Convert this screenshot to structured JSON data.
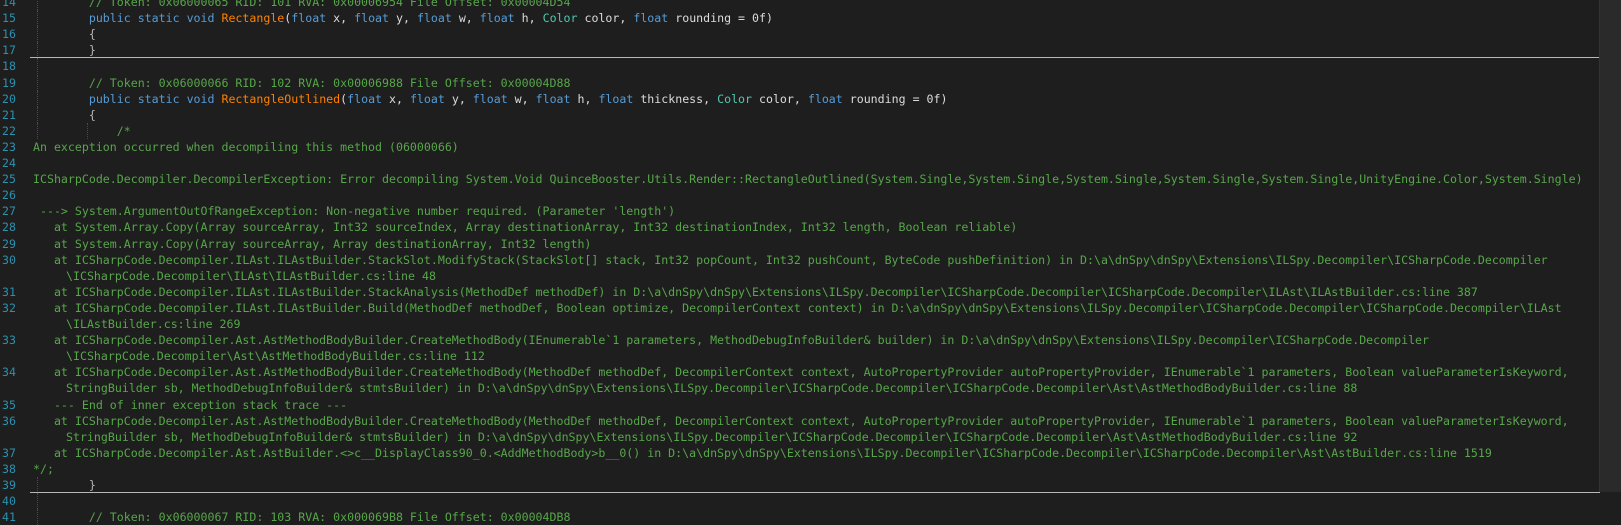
{
  "lines": [
    {
      "n": "14",
      "text": "        // Token: 0x06000065 RID: 101 RVA: 0x00006954 File Offset: 0x00004D54",
      "cls": "cm",
      "indent": 1
    },
    {
      "n": "15",
      "sig": {
        "pre": "public static void ",
        "name": "Rectangle",
        "args": "(float x, float y, float w, float h, Color color, float rounding = 0f)"
      },
      "indent": 1
    },
    {
      "n": "16",
      "text": "        {",
      "cls": "punc",
      "indent": 1
    },
    {
      "n": "17",
      "text": "        }",
      "cls": "punc",
      "indent": 1,
      "sep_after": true
    },
    {
      "n": "18",
      "text": "",
      "indent": 1
    },
    {
      "n": "19",
      "text": "        // Token: 0x06000066 RID: 102 RVA: 0x00006988 File Offset: 0x00004D88",
      "cls": "cm",
      "indent": 1
    },
    {
      "n": "20",
      "sig": {
        "pre": "public static void ",
        "name": "RectangleOutlined",
        "args": "(float x, float y, float w, float h, float thickness, Color color, float rounding = 0f)"
      },
      "indent": 1
    },
    {
      "n": "21",
      "text": "        {",
      "cls": "punc",
      "indent": 1
    },
    {
      "n": "22",
      "text": "            /*",
      "cls": "cm",
      "indent": 2
    },
    {
      "n": "23",
      "text": "An exception occurred when decompiling this method (06000066)",
      "cls": "cm"
    },
    {
      "n": "24",
      "text": "",
      "cls": "cm"
    },
    {
      "n": "25",
      "text": "ICSharpCode.Decompiler.DecompilerException: Error decompiling System.Void QuinceBooster.Utils.Render::RectangleOutlined(System.Single,System.Single,System.Single,System.Single,System.Single,UnityEngine.Color,System.Single)",
      "cls": "cm"
    },
    {
      "n": "26",
      "text": "",
      "cls": "cm"
    },
    {
      "n": "27",
      "text": " ---> System.ArgumentOutOfRangeException: Non-negative number required. (Parameter 'length')",
      "cls": "cm"
    },
    {
      "n": "28",
      "text": "   at System.Array.Copy(Array sourceArray, Int32 sourceIndex, Array destinationArray, Int32 destinationIndex, Int32 length, Boolean reliable)",
      "cls": "cm"
    },
    {
      "n": "29",
      "text": "   at System.Array.Copy(Array sourceArray, Array destinationArray, Int32 length)",
      "cls": "cm"
    },
    {
      "n": "30",
      "text": "   at ICSharpCode.Decompiler.ILAst.ILAstBuilder.StackSlot.ModifyStack(StackSlot[] stack, Int32 popCount, Int32 pushCount, ByteCode pushDefinition) in D:\\a\\dnSpy\\dnSpy\\Extensions\\ILSpy.Decompiler\\ICSharpCode.Decompiler",
      "cls": "cm"
    },
    {
      "n": "",
      "text": "\\ICSharpCode.Decompiler\\ILAst\\ILAstBuilder.cs:line 48",
      "cls": "cm",
      "cont": true
    },
    {
      "n": "31",
      "text": "   at ICSharpCode.Decompiler.ILAst.ILAstBuilder.StackAnalysis(MethodDef methodDef) in D:\\a\\dnSpy\\dnSpy\\Extensions\\ILSpy.Decompiler\\ICSharpCode.Decompiler\\ICSharpCode.Decompiler\\ILAst\\ILAstBuilder.cs:line 387",
      "cls": "cm"
    },
    {
      "n": "32",
      "text": "   at ICSharpCode.Decompiler.ILAst.ILAstBuilder.Build(MethodDef methodDef, Boolean optimize, DecompilerContext context) in D:\\a\\dnSpy\\dnSpy\\Extensions\\ILSpy.Decompiler\\ICSharpCode.Decompiler\\ICSharpCode.Decompiler\\ILAst",
      "cls": "cm"
    },
    {
      "n": "",
      "text": "\\ILAstBuilder.cs:line 269",
      "cls": "cm",
      "cont": true
    },
    {
      "n": "33",
      "text": "   at ICSharpCode.Decompiler.Ast.AstMethodBodyBuilder.CreateMethodBody(IEnumerable`1 parameters, MethodDebugInfoBuilder& builder) in D:\\a\\dnSpy\\dnSpy\\Extensions\\ILSpy.Decompiler\\ICSharpCode.Decompiler",
      "cls": "cm"
    },
    {
      "n": "",
      "text": "\\ICSharpCode.Decompiler\\Ast\\AstMethodBodyBuilder.cs:line 112",
      "cls": "cm",
      "cont": true
    },
    {
      "n": "34",
      "text": "   at ICSharpCode.Decompiler.Ast.AstMethodBodyBuilder.CreateMethodBody(MethodDef methodDef, DecompilerContext context, AutoPropertyProvider autoPropertyProvider, IEnumerable`1 parameters, Boolean valueParameterIsKeyword,",
      "cls": "cm"
    },
    {
      "n": "",
      "text": "StringBuilder sb, MethodDebugInfoBuilder& stmtsBuilder) in D:\\a\\dnSpy\\dnSpy\\Extensions\\ILSpy.Decompiler\\ICSharpCode.Decompiler\\ICSharpCode.Decompiler\\Ast\\AstMethodBodyBuilder.cs:line 88",
      "cls": "cm",
      "cont": true
    },
    {
      "n": "35",
      "text": "   --- End of inner exception stack trace ---",
      "cls": "cm"
    },
    {
      "n": "36",
      "text": "   at ICSharpCode.Decompiler.Ast.AstMethodBodyBuilder.CreateMethodBody(MethodDef methodDef, DecompilerContext context, AutoPropertyProvider autoPropertyProvider, IEnumerable`1 parameters, Boolean valueParameterIsKeyword,",
      "cls": "cm"
    },
    {
      "n": "",
      "text": "StringBuilder sb, MethodDebugInfoBuilder& stmtsBuilder) in D:\\a\\dnSpy\\dnSpy\\Extensions\\ILSpy.Decompiler\\ICSharpCode.Decompiler\\ICSharpCode.Decompiler\\Ast\\AstMethodBodyBuilder.cs:line 92",
      "cls": "cm",
      "cont": true
    },
    {
      "n": "37",
      "text": "   at ICSharpCode.Decompiler.Ast.AstBuilder.<>c__DisplayClass90_0.<AddMethodBody>b__0() in D:\\a\\dnSpy\\dnSpy\\Extensions\\ILSpy.Decompiler\\ICSharpCode.Decompiler\\ICSharpCode.Decompiler\\Ast\\AstBuilder.cs:line 1519",
      "cls": "cm"
    },
    {
      "n": "38",
      "text": "*/;",
      "cls": "cm"
    },
    {
      "n": "39",
      "text": "        }",
      "cls": "punc",
      "indent": 1,
      "sep_after": true
    },
    {
      "n": "40",
      "text": "",
      "indent": 1
    },
    {
      "n": "41",
      "text": "        // Token: 0x06000067 RID: 103 RVA: 0x000069B8 File Offset: 0x00004DB8",
      "cls": "cm",
      "indent": 1
    }
  ],
  "layout_hint": {
    "line_number_color": "#2b91af",
    "comment_color": "#57a64a",
    "keyword_color": "#569cd6",
    "method_name_color": "#ff8000",
    "background": "#1e1e1e"
  }
}
